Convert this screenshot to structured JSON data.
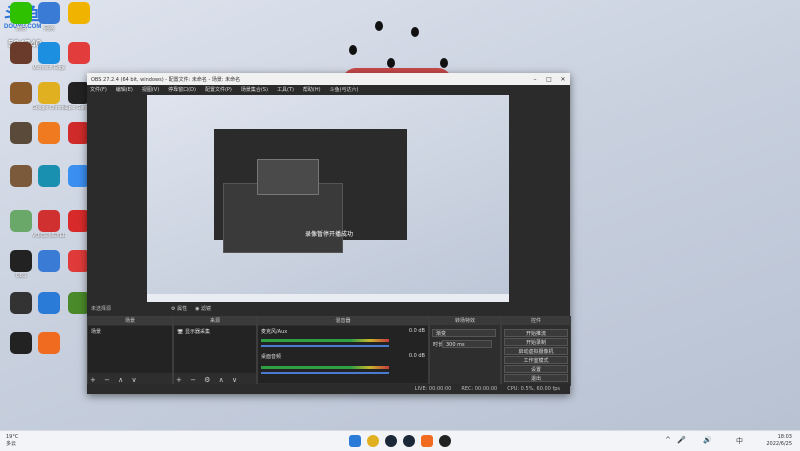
{
  "desktop": {
    "logo_text": "斗鱼",
    "logo_sub": "DOUYU.COM",
    "counter": "534740",
    "icons": [
      {
        "name": "wechat-icon",
        "label": "微信",
        "color": "#2dc100"
      },
      {
        "name": "network-icon",
        "label": "网络",
        "color": "#3a7bd5"
      },
      {
        "name": "qq-pet-icon",
        "label": "",
        "color": "#f0b400"
      },
      {
        "name": "game-icon",
        "label": "",
        "color": "#6a3b2a"
      },
      {
        "name": "edge-icon",
        "label": "Microsoft Edge",
        "color": "#1d8fe0"
      },
      {
        "name": "app-red-icon",
        "label": "",
        "color": "#e33c3c"
      },
      {
        "name": "game2-icon",
        "label": "",
        "color": "#8a5a2a"
      },
      {
        "name": "chrome-icon",
        "label": "Google Chrome",
        "color": "#e0b020"
      },
      {
        "name": "epic-icon",
        "label": "Epic Games",
        "color": "#222"
      },
      {
        "name": "game3-icon",
        "label": "",
        "color": "#5a4a3a"
      },
      {
        "name": "app-orange-icon",
        "label": "",
        "color": "#f07a20"
      },
      {
        "name": "app-red2-icon",
        "label": "",
        "color": "#d02a2a"
      },
      {
        "name": "game4-icon",
        "label": "",
        "color": "#7a5a3a"
      },
      {
        "name": "app-teal-icon",
        "label": "",
        "color": "#1a90b0"
      },
      {
        "name": "baidu-icon",
        "label": "",
        "color": "#3a8ff0"
      },
      {
        "name": "gallery-icon",
        "label": "",
        "color": "#6aa86a"
      },
      {
        "name": "voicemeeter-icon",
        "label": "VOICE METER",
        "color": "#d03030"
      },
      {
        "name": "netease-icon",
        "label": "",
        "color": "#d82a2a"
      },
      {
        "name": "obs-icon",
        "label": "OBS",
        "color": "#222"
      },
      {
        "name": "app-blue-icon",
        "label": "",
        "color": "#3a7bd5"
      },
      {
        "name": "app-red3-icon",
        "label": "",
        "color": "#e03a3a"
      },
      {
        "name": "app-dark-icon",
        "label": "",
        "color": "#333"
      },
      {
        "name": "app-blue2-icon",
        "label": "",
        "color": "#2a7ad8"
      },
      {
        "name": "app-green-icon",
        "label": "",
        "color": "#4a8a2a"
      },
      {
        "name": "qq-icon",
        "label": "",
        "color": "#222"
      },
      {
        "name": "app-orange2-icon",
        "label": "",
        "color": "#f06a20"
      }
    ]
  },
  "obs": {
    "title": "OBS 27.2.4 (64 bit, windows) - 配置文件: 未命名 - 场景: 未命名",
    "menu": [
      "文件(F)",
      "编辑(E)",
      "视图(V)",
      "停靠窗口(D)",
      "配置文件(P)",
      "场景集合(S)",
      "工具(T)",
      "帮助(H)",
      "斗鱼(弓达六)"
    ],
    "toast": "录像暂停开播成功",
    "status_label": "未选择源",
    "props_label": "属性",
    "filter_label": "滤镜",
    "docks": {
      "scenes": {
        "title": "场景",
        "items": [
          "场景"
        ]
      },
      "sources": {
        "title": "来源",
        "items": [
          "显示器采集"
        ]
      },
      "mixer": {
        "title": "混音器",
        "channels": [
          {
            "name": "麦克风/Aux",
            "db": "0.0 dB"
          },
          {
            "name": "桌面音频",
            "db": "0.0 dB"
          }
        ]
      },
      "transitions": {
        "title": "转场特效",
        "type": "渐变",
        "duration_label": "时长",
        "duration": "300 ms"
      },
      "controls": {
        "title": "控件",
        "buttons": [
          "开始推流",
          "开始录制",
          "启动虚拟摄像机",
          "工作室模式",
          "设置",
          "退出"
        ]
      }
    },
    "bottom": {
      "live": "LIVE: 00:00:00",
      "rec": "REC: 00:00:00",
      "cpu": "CPU: 0.5%, 60.00 fps"
    }
  },
  "taskbar": {
    "weather_temp": "19°C",
    "weather_text": "多云",
    "time": "18:03",
    "date": "2022/6/25",
    "lang": "中"
  },
  "colors": {
    "obs_bg": "#2b2b2b",
    "accent": "#4a7bd0"
  }
}
